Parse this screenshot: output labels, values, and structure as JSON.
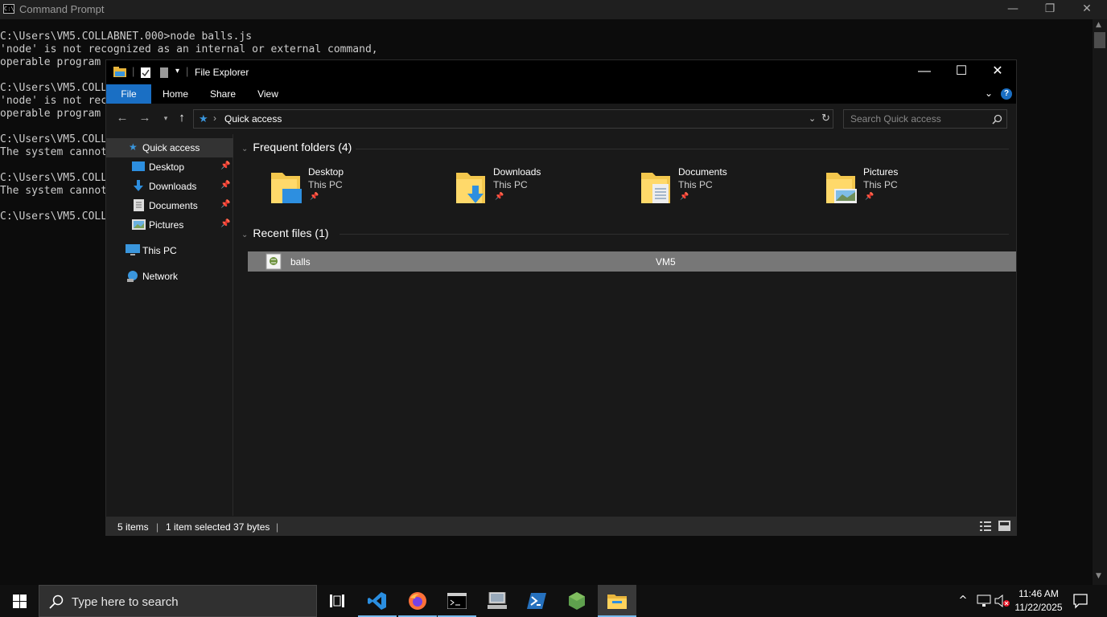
{
  "cmd": {
    "title": "Command Prompt",
    "icon_text": "C:\\",
    "lines": [
      "C:\\Users\\VM5.COLLABNET.000>node balls.js",
      "'node' is not recognized as an internal or external command,",
      "operable program",
      "",
      "C:\\Users\\VM5.COLL",
      "'node' is not rec",
      "operable program",
      "",
      "C:\\Users\\VM5.COLL",
      "The system cannot",
      "",
      "C:\\Users\\VM5.COLL",
      "The system cannot",
      "",
      "C:\\Users\\VM5.COLL"
    ],
    "controls": {
      "minimize": "—",
      "restore": "❐",
      "close": "✕"
    }
  },
  "explorer": {
    "title": "File Explorer",
    "controls": {
      "minimize": "—",
      "maximize": "☐",
      "close": "✕"
    },
    "ribbon_tabs": [
      "File",
      "Home",
      "Share",
      "View"
    ],
    "help": "?",
    "address": {
      "crumb": "Quick access",
      "separator": "›"
    },
    "search_placeholder": "Search Quick access",
    "nav": {
      "quick_access": "Quick access",
      "items": [
        {
          "label": "Desktop",
          "pinned": true
        },
        {
          "label": "Downloads",
          "pinned": true
        },
        {
          "label": "Documents",
          "pinned": true
        },
        {
          "label": "Pictures",
          "pinned": true
        }
      ],
      "this_pc": "This PC",
      "network": "Network"
    },
    "frequent": {
      "header": "Frequent folders (4)",
      "folders": [
        {
          "name": "Desktop",
          "location": "This PC"
        },
        {
          "name": "Downloads",
          "location": "This PC"
        },
        {
          "name": "Documents",
          "location": "This PC"
        },
        {
          "name": "Pictures",
          "location": "This PC"
        }
      ]
    },
    "recent": {
      "header": "Recent files (1)",
      "files": [
        {
          "name": "balls",
          "location": "VM5"
        }
      ]
    },
    "status": {
      "items": "5 items",
      "selected": "1 item selected  37 bytes",
      "sep": "|"
    }
  },
  "taskbar": {
    "search_placeholder": "Type here to search",
    "apps": [
      "task-view",
      "vs-code",
      "firefox",
      "terminal",
      "remote-desktop",
      "powershell",
      "nodejs",
      "file-explorer"
    ],
    "clock": {
      "time": "11:46 AM",
      "date": "11/22/2025"
    },
    "tray": [
      "show-hidden",
      "network",
      "volume-muted",
      "notifications"
    ]
  },
  "colors": {
    "accent": "#1a6fc4",
    "quick_access_star": "#3a96dd",
    "folder_yellow": "#f3c74d",
    "selected_row": "#777777"
  }
}
